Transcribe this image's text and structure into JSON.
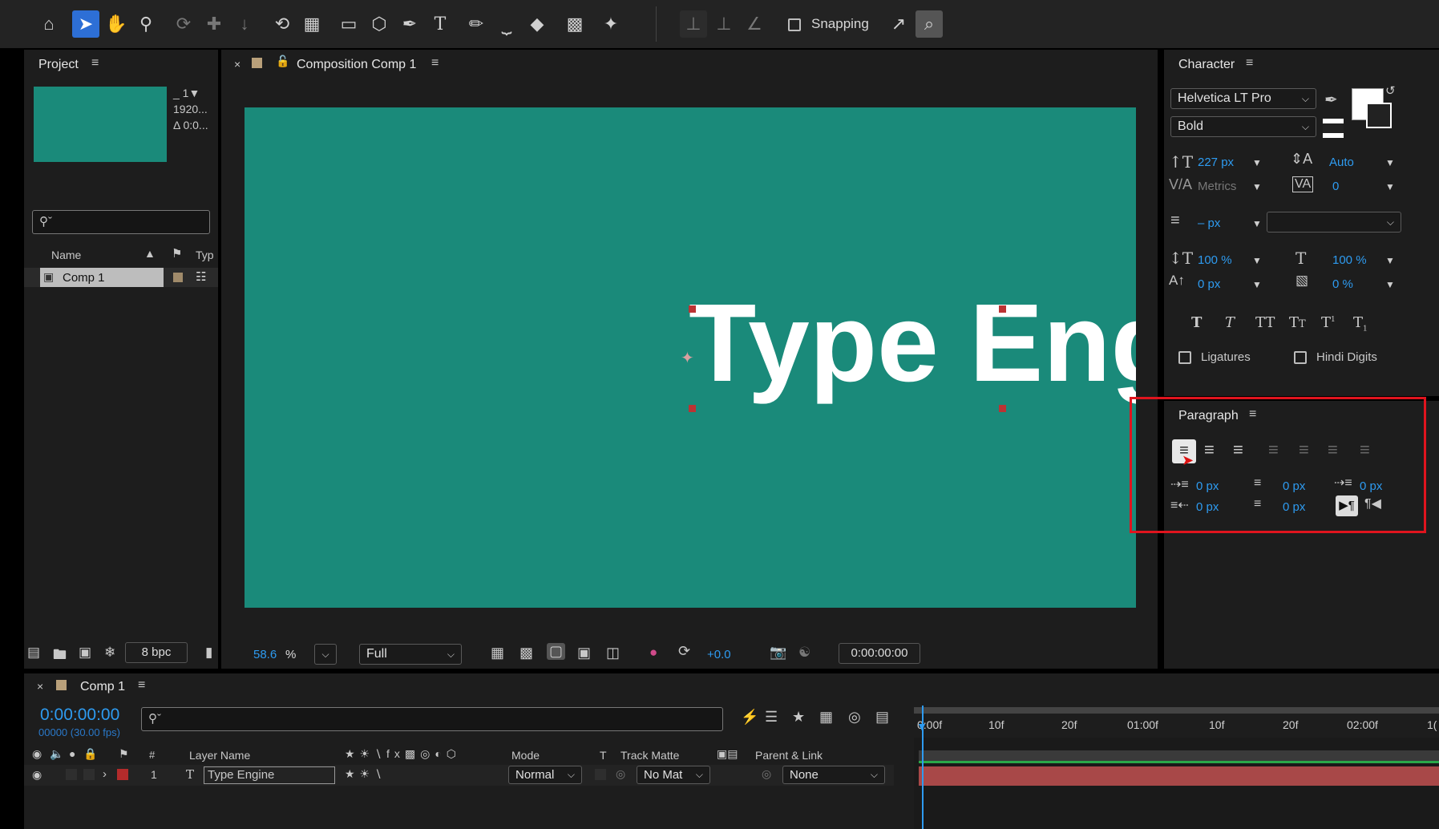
{
  "toolbar": {
    "snapping_label": "Snapping",
    "snapping_checked": false
  },
  "project": {
    "title": "Project",
    "thumb_info": [
      "_ 1▼",
      "1920...",
      "Δ 0:0..."
    ],
    "columns": {
      "name": "Name",
      "type": "Typ"
    },
    "items": [
      {
        "name": "Comp 1"
      }
    ],
    "bpc": "8 bpc"
  },
  "composition": {
    "tab_title": "Composition Comp 1",
    "canvas_text": "Type Eng",
    "bg_color": "#1a8a7a",
    "zoom": "58.6",
    "zoom_unit": "%",
    "resolution": "Full",
    "exposure": "+0.0",
    "timecode": "0:00:00:00"
  },
  "character": {
    "title": "Character",
    "font_family": "Helvetica LT Pro",
    "font_style": "Bold",
    "font_size": "227 px",
    "leading": "Auto",
    "kerning": "Metrics",
    "tracking": "0",
    "stroke_width": "– px",
    "vscale": "100 %",
    "hscale": "100 %",
    "baseline": "0 px",
    "tsume": "0 %",
    "ligatures_label": "Ligatures",
    "hindi_label": "Hindi Digits"
  },
  "paragraph": {
    "title": "Paragraph",
    "indent_left": "0 px",
    "indent_right": "0 px",
    "space_before": "0 px",
    "first_line": "0 px",
    "space_after": "0 px",
    "highlight_color": "#e0141e"
  },
  "timeline": {
    "tab_title": "Comp 1",
    "timecode": "0:00:00:00",
    "frames": "00000 (30.00 fps)",
    "ruler": [
      "0:00f",
      "10f",
      "20f",
      "01:00f",
      "10f",
      "20f",
      "02:00f",
      "1("
    ],
    "columns": {
      "layer_name": "Layer Name",
      "mode": "Mode",
      "t": "T",
      "track_matte": "Track Matte",
      "parent": "Parent & Link"
    },
    "layers": [
      {
        "num": "1",
        "name": "Type Engine",
        "mode": "Normal",
        "matte": "No Mat",
        "parent": "None"
      }
    ]
  }
}
